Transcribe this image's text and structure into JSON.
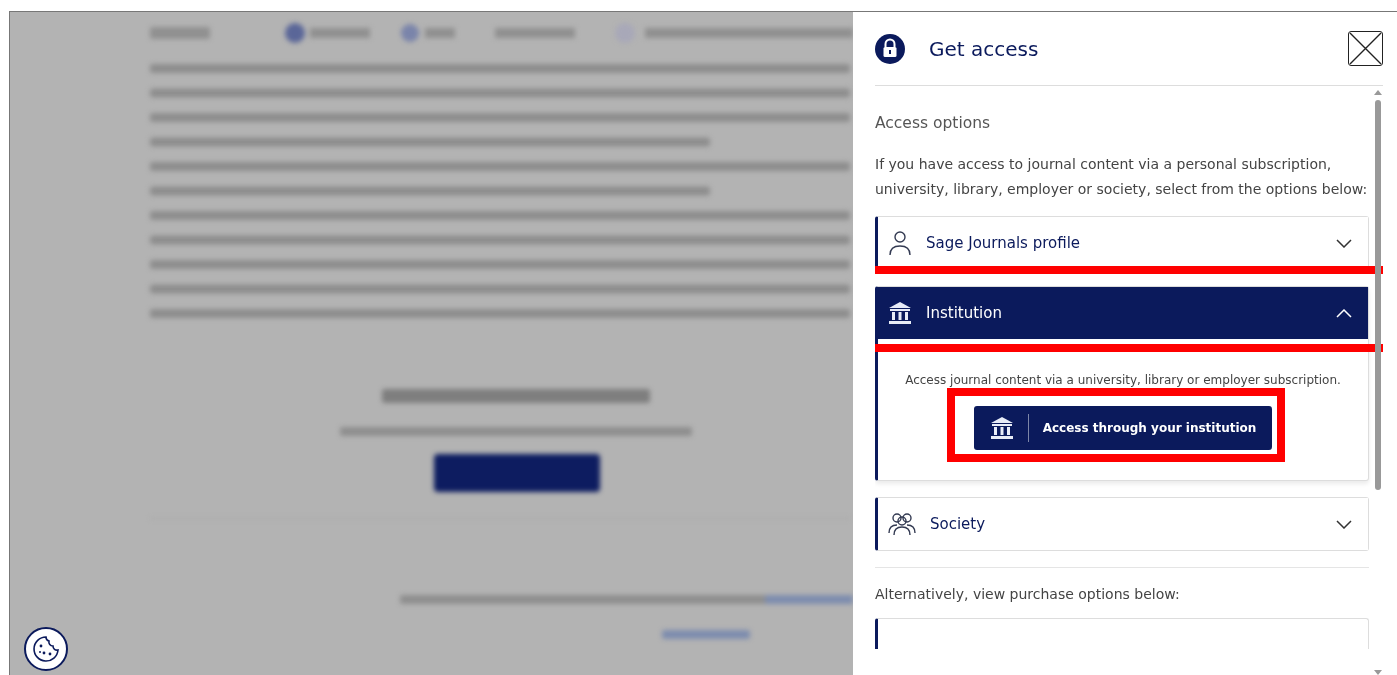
{
  "panel": {
    "title": "Get access",
    "section_title": "Access options",
    "intro": "If you have access to journal content via a personal subscription, university, library, employer or society, select from the options below:",
    "options": [
      {
        "kind": "person",
        "label": "Sage Journals profile",
        "expanded": false,
        "highlighted": false
      },
      {
        "kind": "institution",
        "label": "Institution",
        "expanded": true,
        "highlighted": true,
        "body": "Access journal content via a university, library or employer subscription.",
        "button": {
          "label": "Access through your institution",
          "highlighted": true
        }
      },
      {
        "kind": "group",
        "label": "Society",
        "expanded": false,
        "highlighted": false
      }
    ],
    "purchase_intro": "Alternatively, view purchase options below:"
  }
}
